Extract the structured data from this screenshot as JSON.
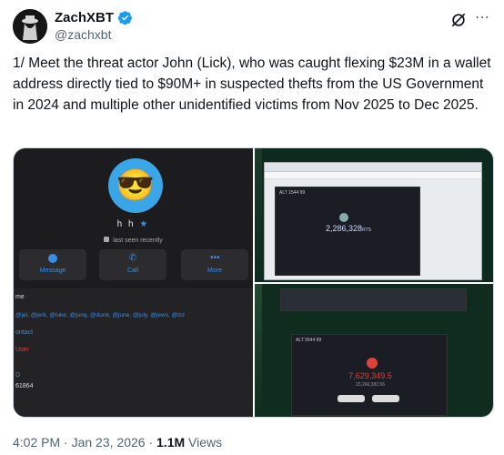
{
  "author": {
    "display_name": "ZachXBT",
    "handle": "@zachxbt",
    "verified": true,
    "avatar_icon": "detective-avatar-icon"
  },
  "tweet": {
    "text": "1/ Meet the threat actor John (Lick), who was caught flexing $23M in a wallet address directly tied to $90M+  in suspected thefts from the US Government in 2024 and multiple other unidentified victims from Nov 2025 to Dec 2025."
  },
  "media": {
    "telegram_profile": {
      "name": "h h",
      "last_seen": "last seen recently",
      "buttons": [
        {
          "label": "Message",
          "icon": "message-icon"
        },
        {
          "label": "Call",
          "icon": "phone-icon"
        },
        {
          "label": "More",
          "icon": "more-icon"
        }
      ],
      "section_title": "me",
      "usernames": "@jel, @jerk, @luke, @junq, @dunk, @june, @july, @jews, @lzz",
      "contact_label": "ontact",
      "user_label": "User",
      "id_label": "D",
      "id_value": "61864"
    },
    "wallet_top": {
      "title": "ALT 1544 99",
      "amount": "2,286,328",
      "unit": "RTS"
    },
    "wallet_bottom": {
      "title": "ALT 5544 99",
      "amount": "7,629,349.5",
      "sub": "23,266,382.56"
    }
  },
  "meta": {
    "time": "4:02 PM",
    "separator": "·",
    "date": "Jan 23, 2026",
    "views_count": "1.1M",
    "views_label": "Views"
  },
  "colors": {
    "verified_blue": "#1d9bf0",
    "telegram_blue": "#3a8ee6",
    "red_accent": "#e0413a"
  }
}
